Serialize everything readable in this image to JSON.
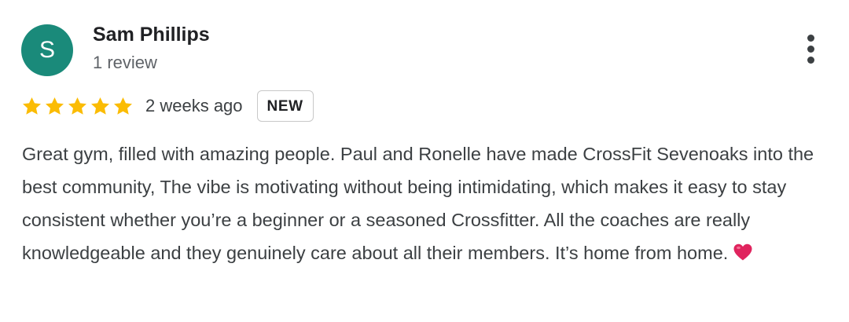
{
  "review": {
    "avatar_initial": "S",
    "reviewer_name": "Sam Phillips",
    "review_count": "1 review",
    "rating": 5,
    "rating_max": 5,
    "date": "2 weeks ago",
    "badge": "NEW",
    "text": "Great gym, filled with amazing people. Paul and Ronelle have made CrossFit Sevenoaks into the best community, The vibe is motivating without being intimidating, which makes it easy to stay consistent whether you’re a beginner or a seasoned Crossfitter. All the coaches are really knowledgeable and they genuinely care about all their members. It’s home from home.",
    "emoji": "red-heart-icon",
    "more_icon": "more-vert-icon"
  },
  "colors": {
    "avatar_bg": "#1a8a7a",
    "star": "#fbbc04",
    "heart": "#e0245e"
  }
}
